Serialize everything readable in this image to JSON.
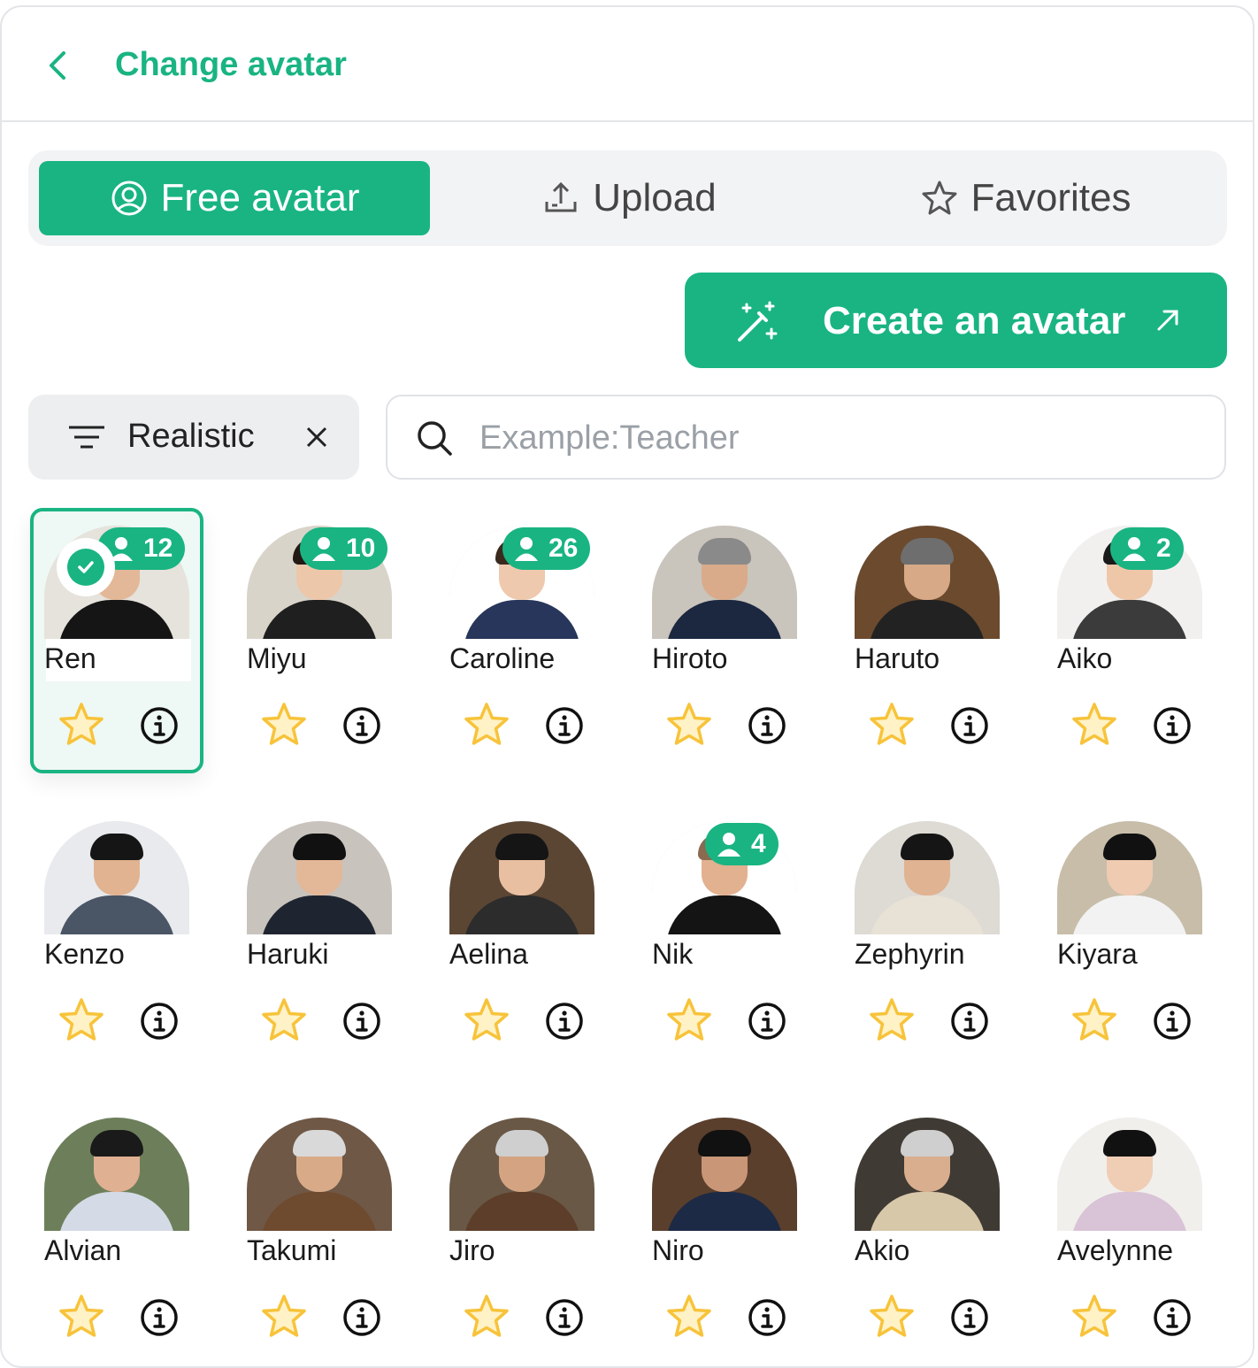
{
  "header": {
    "title": "Change avatar"
  },
  "tabs": [
    {
      "label": "Free avatar",
      "icon": "user-circle-icon",
      "active": true
    },
    {
      "label": "Upload",
      "icon": "upload-icon",
      "active": false
    },
    {
      "label": "Favorites",
      "icon": "star-outline-icon",
      "active": false
    }
  ],
  "create_button": {
    "label": "Create an avatar",
    "icon": "magic-wand-icon",
    "trailing_icon": "external-arrow-icon"
  },
  "filter": {
    "label": "Realistic",
    "icon": "filter-lines-icon",
    "clear_icon": "close-icon"
  },
  "search": {
    "placeholder": "Example:Teacher",
    "value": "",
    "icon": "search-icon"
  },
  "colors": {
    "accent": "#19b482",
    "star": "#f7c33a",
    "border": "#e3e5e8"
  },
  "avatars": [
    {
      "name": "Ren",
      "badge": "12",
      "selected": true
    },
    {
      "name": "Miyu",
      "badge": "10"
    },
    {
      "name": "Caroline",
      "badge": "26"
    },
    {
      "name": "Hiroto",
      "badge": ""
    },
    {
      "name": "Haruto",
      "badge": ""
    },
    {
      "name": "Aiko",
      "badge": "2"
    },
    {
      "name": "Kenzo",
      "badge": ""
    },
    {
      "name": "Haruki",
      "badge": ""
    },
    {
      "name": "Aelina",
      "badge": ""
    },
    {
      "name": "Nik",
      "badge": "4"
    },
    {
      "name": "Zephyrin",
      "badge": ""
    },
    {
      "name": "Kiyara",
      "badge": ""
    },
    {
      "name": "Alvian",
      "badge": ""
    },
    {
      "name": "Takumi",
      "badge": ""
    },
    {
      "name": "Jiro",
      "badge": ""
    },
    {
      "name": "Niro",
      "badge": ""
    },
    {
      "name": "Akio",
      "badge": ""
    },
    {
      "name": "Avelynne",
      "badge": ""
    }
  ]
}
